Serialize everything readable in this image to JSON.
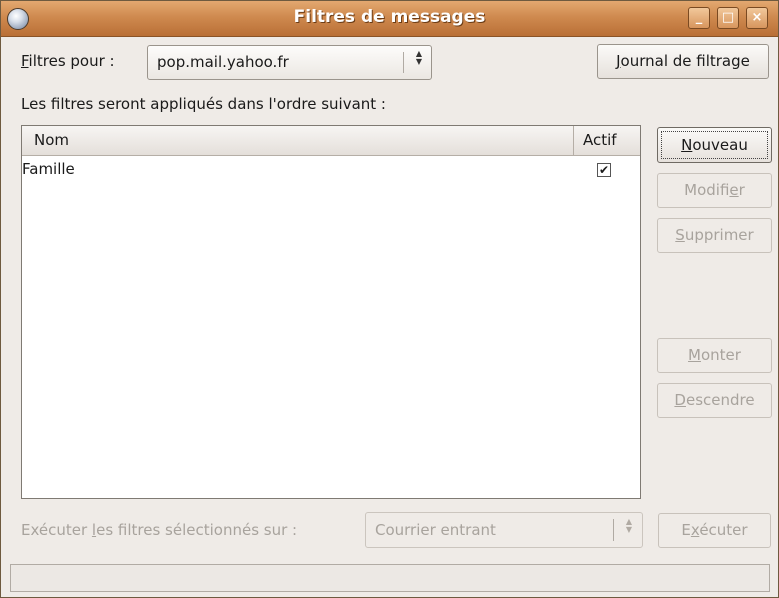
{
  "window": {
    "title": "Filtres de messages",
    "minimize_glyph": "_",
    "maximize_glyph": "□",
    "close_glyph": "×"
  },
  "filters_for": {
    "label_first": "F",
    "label_rest": "iltres pour :",
    "account": "pop.mail.yahoo.fr"
  },
  "journal_button": {
    "label_first": "J",
    "label_rest": "ournal de filtrage"
  },
  "order_text": "Les filtres seront appliqués dans l'ordre suivant :",
  "list": {
    "columns": [
      "Nom",
      "Actif"
    ],
    "rows": [
      {
        "name": "Famille",
        "active": true,
        "check_glyph": "✔"
      }
    ]
  },
  "buttons": {
    "nouveau": {
      "first": "N",
      "rest": "ouveau",
      "enabled": true
    },
    "modifier": {
      "pre": "Modifi",
      "u": "e",
      "post": "r",
      "enabled": false
    },
    "supprimer": {
      "first": "S",
      "rest": "upprimer",
      "enabled": false
    },
    "monter": {
      "first": "M",
      "rest": "onter",
      "enabled": false
    },
    "descendre": {
      "first": "D",
      "rest": "escendre",
      "enabled": false
    }
  },
  "run": {
    "label_pre": "Exécuter ",
    "label_u": "l",
    "label_post": "es filtres sélectionnés sur :",
    "folder": "Courrier entrant",
    "button_pre": "E",
    "button_u": "x",
    "button_post": "écuter"
  },
  "icons": {
    "app": "thunderbird-icon",
    "combo_arrows": "up-down-arrows-icon"
  }
}
